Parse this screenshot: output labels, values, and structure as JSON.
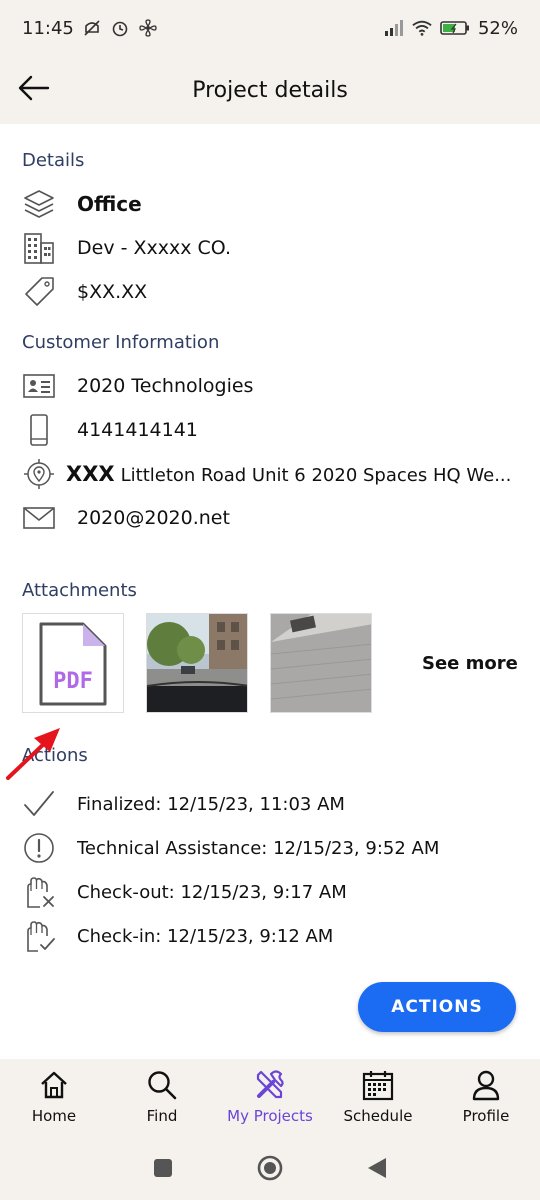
{
  "status": {
    "time": "11:45",
    "battery": "52%"
  },
  "app_bar": {
    "title": "Project details"
  },
  "details": {
    "section_title": "Details",
    "type": "Office",
    "company": "Dev - Xxxxx CO.",
    "price": "$XX.XX"
  },
  "customer": {
    "section_title": "Customer Information",
    "name": "2020 Technologies",
    "phone": "4141414141",
    "address_prefix": "XXX",
    "address": "Littleton Road Unit 6 2020 Spaces HQ We...",
    "email": "2020@2020.net"
  },
  "attachments": {
    "section_title": "Attachments",
    "pdf_label": "PDF",
    "see_more": "See more"
  },
  "actions": {
    "section_title": "Actions",
    "items": [
      {
        "label": "Finalized: 12/15/23, 11:03 AM"
      },
      {
        "label": "Technical Assistance: 12/15/23, 9:52 AM"
      },
      {
        "label": "Check-out: 12/15/23, 9:17 AM"
      },
      {
        "label": "Check-in: 12/15/23, 9:12 AM"
      }
    ],
    "fab_label": "ACTIONS"
  },
  "nav": {
    "items": [
      {
        "label": "Home"
      },
      {
        "label": "Find"
      },
      {
        "label": "My Projects"
      },
      {
        "label": "Schedule"
      },
      {
        "label": "Profile"
      }
    ]
  },
  "colors": {
    "accent": "#1b6cf2",
    "active_nav": "#6a45d6",
    "section_title": "#2f3e62",
    "bar_bg": "#f5f1ec"
  }
}
